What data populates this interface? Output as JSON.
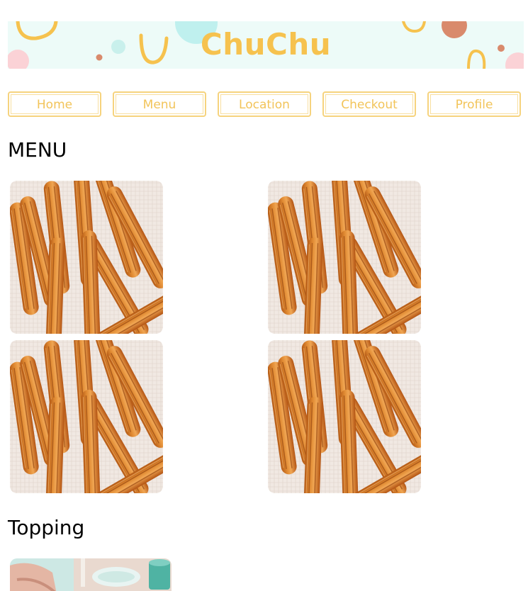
{
  "banner": {
    "title": "ChuChu",
    "colors": {
      "background": "#edfbf8",
      "accent": "#f6c24e"
    }
  },
  "nav": {
    "items": [
      {
        "label": "Home"
      },
      {
        "label": "Menu"
      },
      {
        "label": "Location"
      },
      {
        "label": "Checkout"
      },
      {
        "label": "Profile"
      }
    ]
  },
  "menu": {
    "heading": "MENU",
    "items": [
      {
        "image": "churros-photo"
      },
      {
        "image": "churros-photo"
      },
      {
        "image": "churros-photo"
      },
      {
        "image": "churros-photo"
      }
    ]
  },
  "topping": {
    "heading": "Topping",
    "items": [
      {
        "image": "topping-photo"
      }
    ]
  }
}
